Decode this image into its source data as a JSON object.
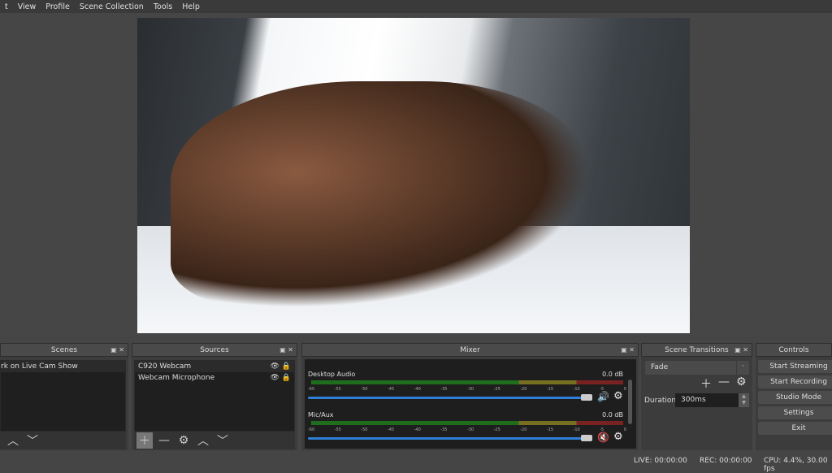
{
  "menu": [
    "t",
    "View",
    "Profile",
    "Scene Collection",
    "Tools",
    "Help"
  ],
  "preview": {
    "description_icon": "video-preview"
  },
  "scenes": {
    "title": "Scenes",
    "items": [
      "rk on Live Cam Show"
    ]
  },
  "sources": {
    "title": "Sources",
    "items": [
      "C920 Webcam",
      "Webcam Microphone"
    ]
  },
  "mixer": {
    "title": "Mixer",
    "ticks": [
      "-60",
      "-55",
      "-50",
      "-45",
      "-40",
      "-35",
      "-30",
      "-25",
      "-20",
      "-15",
      "-10",
      "-5",
      "0"
    ],
    "channels": [
      {
        "name": "Desktop Audio",
        "db": "0.0 dB",
        "muted": false,
        "volume": 1.0
      },
      {
        "name": "Mic/Aux",
        "db": "0.0 dB",
        "muted": true,
        "volume": 1.0
      }
    ]
  },
  "transitions": {
    "title": "Scene Transitions",
    "selected": "Fade",
    "duration_label": "Duration",
    "duration": "300ms"
  },
  "controls": {
    "title": "Controls",
    "buttons": [
      "Start Streaming",
      "Start Recording",
      "Studio Mode",
      "Settings",
      "Exit"
    ]
  },
  "status": {
    "live": "LIVE: 00:00:00",
    "rec": "REC: 00:00:00",
    "cpu": "CPU: 4.4%, 30.00 fps"
  },
  "colors": {
    "meter_green": "#1e6e1e",
    "meter_yellow": "#777020",
    "meter_red": "#7a2222",
    "fader": "#2f7fd8",
    "mute": "#e02020"
  }
}
